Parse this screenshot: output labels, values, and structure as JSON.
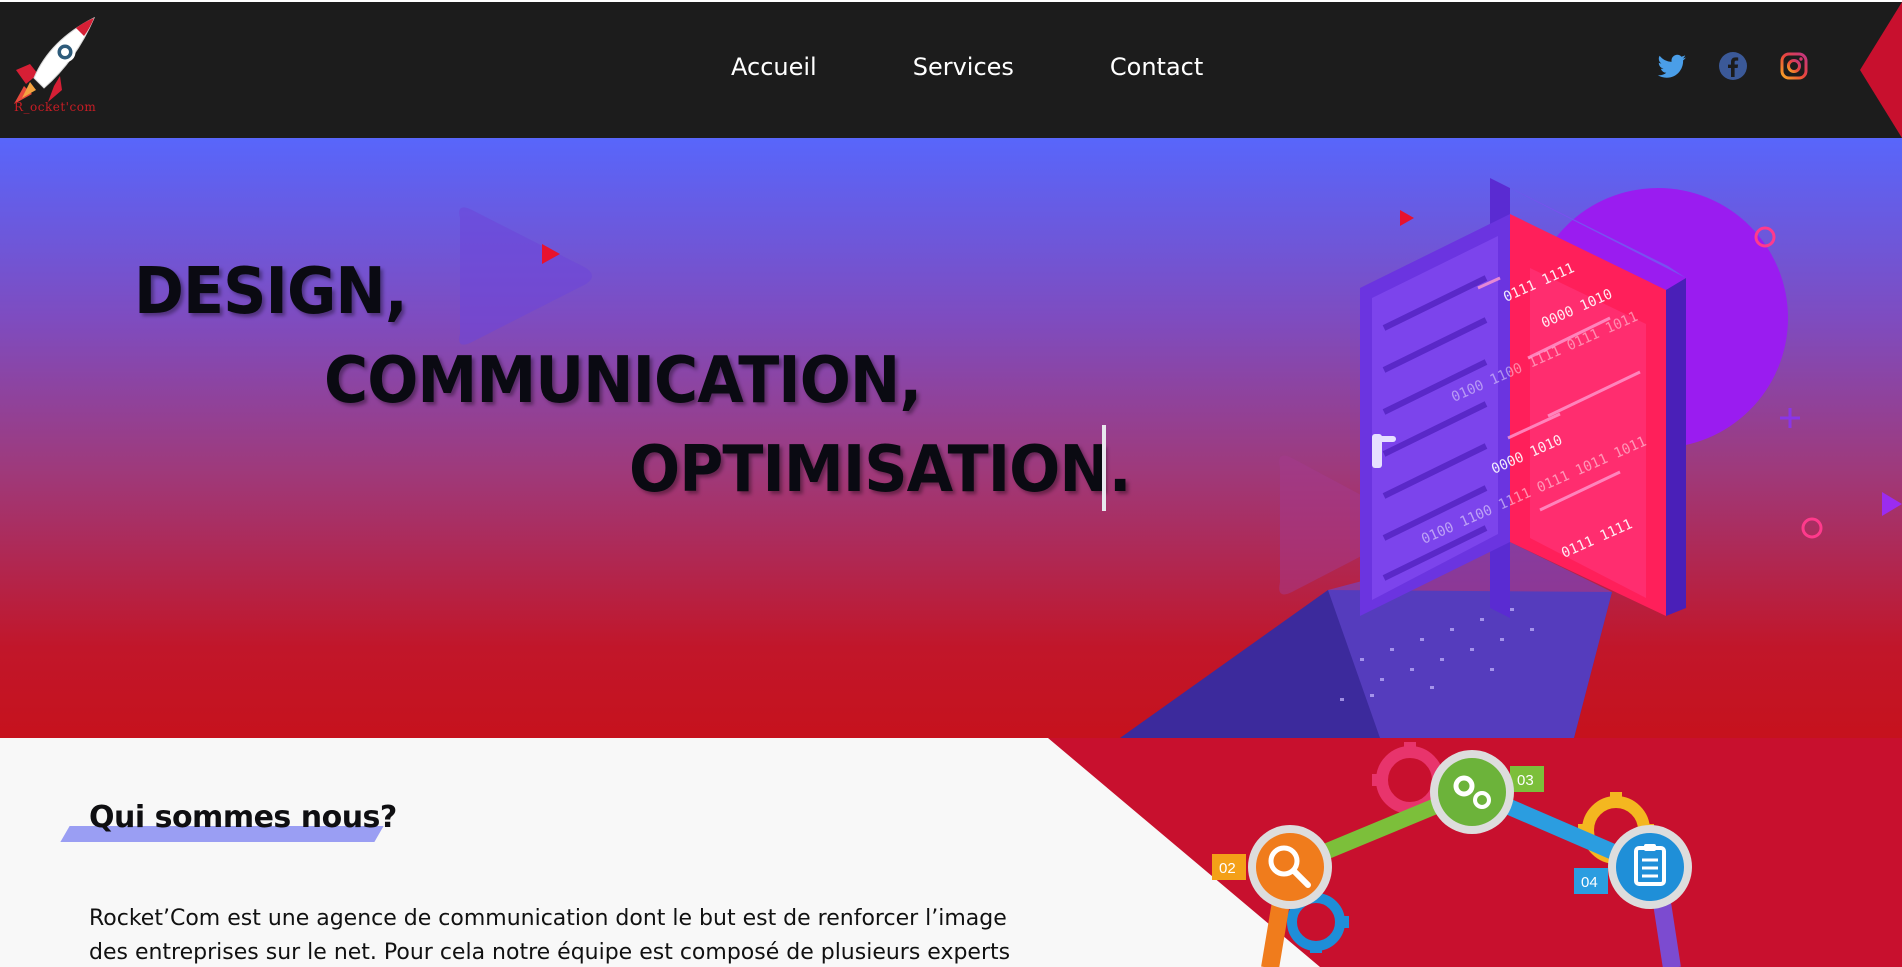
{
  "navbar": {
    "logo_text": "R_ocket'com",
    "links": [
      "Accueil",
      "Services",
      "Contact"
    ],
    "socials": [
      "twitter-icon",
      "facebook-icon",
      "instagram-icon"
    ]
  },
  "hero": {
    "line1": "DESIGN,",
    "line2": "COMMUNICATION,",
    "line3": "OPTIMISATION.",
    "binary": [
      "0111 1111",
      "0000 1010",
      "0100 1100 1111 0111 1011",
      "0000 1010",
      "0100 1100 1111 0111 1011 1011",
      "0111 1111"
    ]
  },
  "about": {
    "title": "Qui sommes nous?",
    "text": "Rocket’Com est une agence de communication dont le but est de renforcer l’image des entreprises sur le net. Pour cela notre équipe est composé de plusieurs experts"
  },
  "process": {
    "steps": [
      "02",
      "03",
      "04"
    ]
  },
  "colors": {
    "nav_bg": "#1c1c1c",
    "hero_top": "#5866fb",
    "hero_bottom": "#c6121d",
    "accent_red": "#c8102e",
    "title_highlight": "#8f93f2"
  }
}
